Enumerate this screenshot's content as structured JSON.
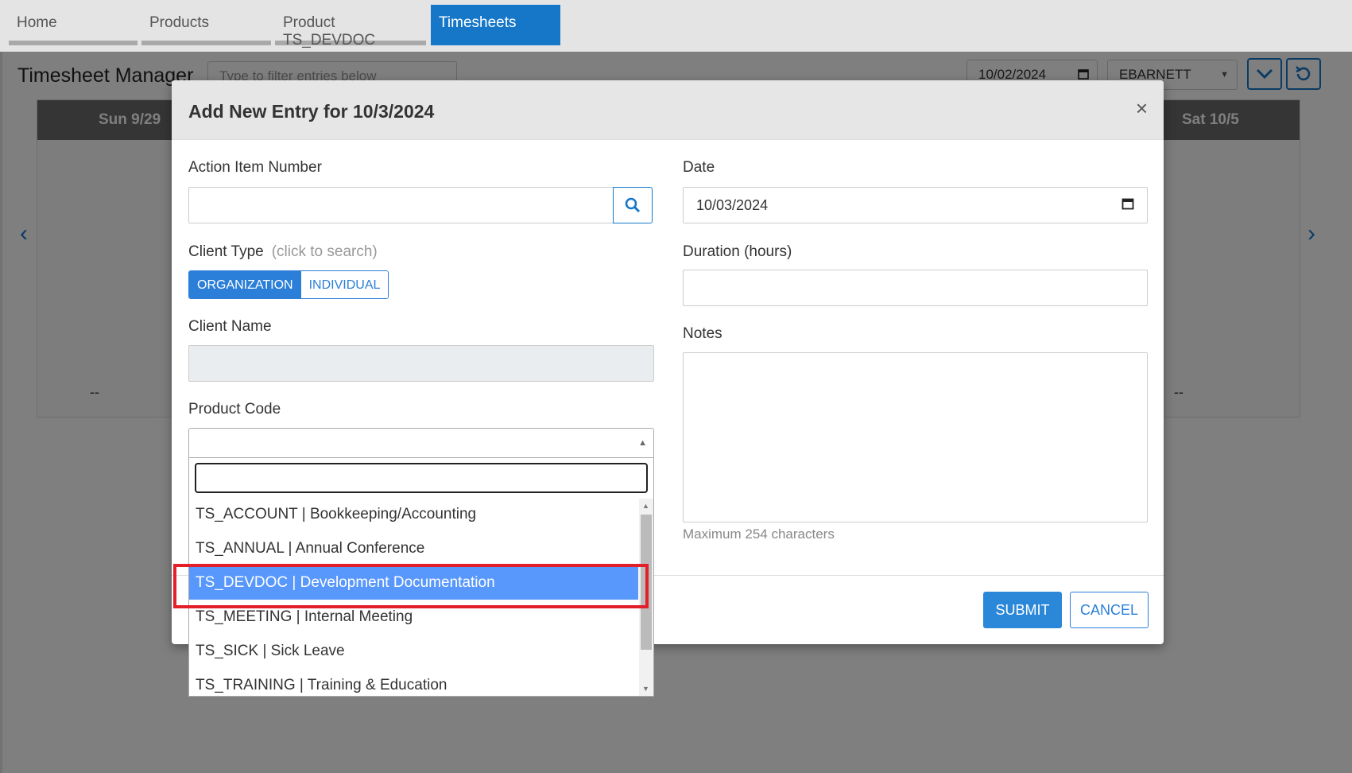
{
  "nav": {
    "tabs": [
      {
        "label": "Home"
      },
      {
        "label": "Products"
      },
      {
        "label": "Product TS_DEVDOC"
      },
      {
        "label": "Timesheets"
      }
    ]
  },
  "page": {
    "title": "Timesheet Manager",
    "filter_placeholder": "Type to filter entries below",
    "date": "10/02/2024",
    "user": "EBARNETT",
    "days": [
      "Sun 9/29",
      "Sat 10/5"
    ],
    "empty_marker": "--"
  },
  "modal": {
    "title": "Add New Entry for 10/3/2024",
    "close": "×",
    "action_item_label": "Action Item Number",
    "client_type_label": "Client Type",
    "client_type_hint": "(click to search)",
    "client_type_options": [
      "ORGANIZATION",
      "INDIVIDUAL"
    ],
    "client_name_label": "Client Name",
    "product_code_label": "Product Code",
    "date_label": "Date",
    "date_value": "10/03/2024",
    "duration_label": "Duration (hours)",
    "notes_label": "Notes",
    "notes_hint": "Maximum 254 characters",
    "submit": "SUBMIT",
    "cancel": "CANCEL"
  },
  "product_dropdown": {
    "items": [
      "TS_ACCOUNT | Bookkeeping/Accounting",
      "TS_ANNUAL | Annual Conference",
      "TS_DEVDOC | Development Documentation",
      "TS_MEETING | Internal Meeting",
      "TS_SICK | Sick Leave",
      "TS_TRAINING | Training & Education"
    ],
    "selected_index": 2
  },
  "colors": {
    "accent": "#1677c9",
    "selected_item": "#5897fb",
    "highlight_box": "#e3202a"
  }
}
